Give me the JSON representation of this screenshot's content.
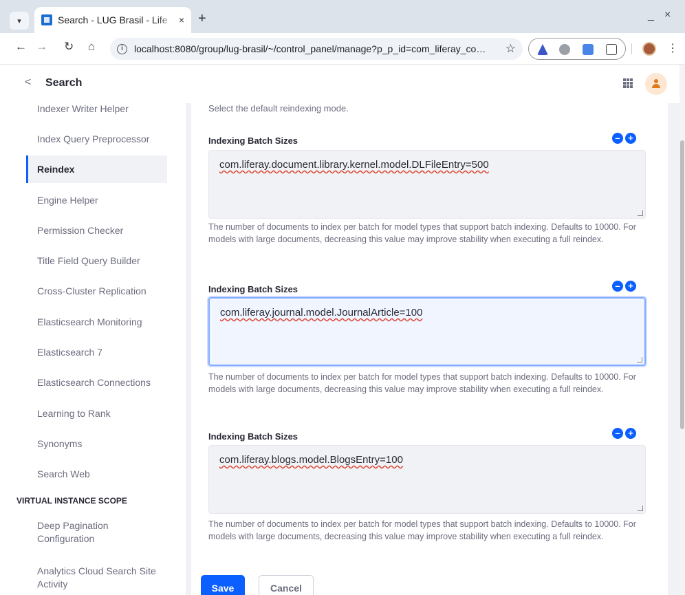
{
  "browser": {
    "tab_title": "Search - LUG Brasil - Life",
    "url": "localhost:8080/group/lug-brasil/~/control_panel/manage?p_p_id=com_liferay_co…",
    "new_tab": "+",
    "tab_close": "×",
    "min_label": "_",
    "close_label": "×"
  },
  "header": {
    "title": "Search"
  },
  "sidebar": {
    "items": [
      "Indexer Writer Helper",
      "Index Query Preprocessor",
      "Reindex",
      "Engine Helper",
      "Permission Checker",
      "Title Field Query Builder",
      "Cross-Cluster Replication",
      "Elasticsearch Monitoring",
      "Elasticsearch 7",
      "Elasticsearch Connections",
      "Learning to Rank",
      "Synonyms",
      "Search Web"
    ],
    "section_heading": "VIRTUAL INSTANCE SCOPE",
    "section_items": [
      "Deep Pagination Configuration",
      "Analytics Cloud Search Site Activity"
    ]
  },
  "main": {
    "desc_top": "Select the default reindexing mode.",
    "fields": [
      {
        "label": "Indexing Batch Sizes",
        "value": "com.liferay.document.library.kernel.model.DLFileEntry=500"
      },
      {
        "label": "Indexing Batch Sizes",
        "value": "com.liferay.journal.model.JournalArticle=100"
      },
      {
        "label": "Indexing Batch Sizes",
        "value": "com.liferay.blogs.model.BlogsEntry=100"
      }
    ],
    "help_text": "The number of documents to index per batch for model types that support batch indexing. Defaults to 10000. For models with large documents, decreasing this value may improve stability when executing a full reindex.",
    "minus": "–",
    "plus": "+"
  },
  "actions": {
    "save": "Save",
    "cancel": "Cancel"
  },
  "colors": {
    "accent": "#0b5fff",
    "panel_bg": "#f1f2f5"
  }
}
